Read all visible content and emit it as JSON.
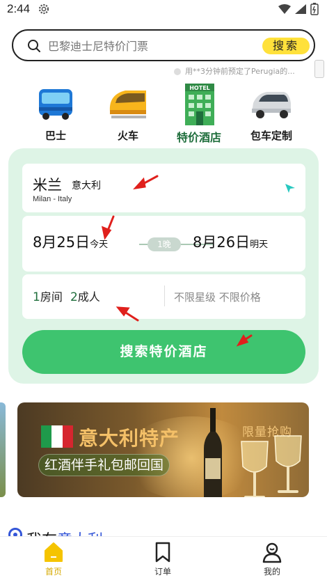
{
  "status_bar": {
    "time": "2:44"
  },
  "search": {
    "placeholder": "巴黎迪士尼特价门票",
    "button_label": "搜索"
  },
  "notice": {
    "text": "用**3分钟前预定了Perugia的..."
  },
  "categories": [
    {
      "label": "巴士",
      "icon": "bus-icon"
    },
    {
      "label": "火车",
      "icon": "train-icon"
    },
    {
      "label": "特价酒店",
      "icon": "hotel-icon",
      "active": true,
      "badge": "HOTEL"
    },
    {
      "label": "包车定制",
      "icon": "car-icon"
    }
  ],
  "booking": {
    "city": "米兰",
    "country": "意大利",
    "city_en": "Milan - Italy",
    "checkin_date": "8月25日",
    "checkin_tag": "今天",
    "nights": "1晚",
    "checkout_date": "8月26日",
    "checkout_tag": "明天",
    "rooms_num": "1",
    "rooms_unit": "房间",
    "guests_num": "2",
    "guests_unit": "成人",
    "filters": "不限星级 不限价格",
    "search_button": "搜索特价酒店"
  },
  "banner": {
    "title": "意大利特产",
    "subtitle": "红酒伴手礼包邮回国",
    "badge": "限量抢购"
  },
  "location_header": {
    "prefix": "我在",
    "city": "意大利"
  },
  "tabs": [
    {
      "label": "首页",
      "icon": "home-icon",
      "active": true
    },
    {
      "label": "订单",
      "icon": "bookmark-icon"
    },
    {
      "label": "我的",
      "icon": "profile-icon"
    }
  ],
  "colors": {
    "accent_green": "#3ec46f",
    "panel_bg": "#def4e6",
    "search_yellow": "#ffe13b",
    "active_tab": "#d6a900",
    "annotation_red": "#e0201c"
  }
}
